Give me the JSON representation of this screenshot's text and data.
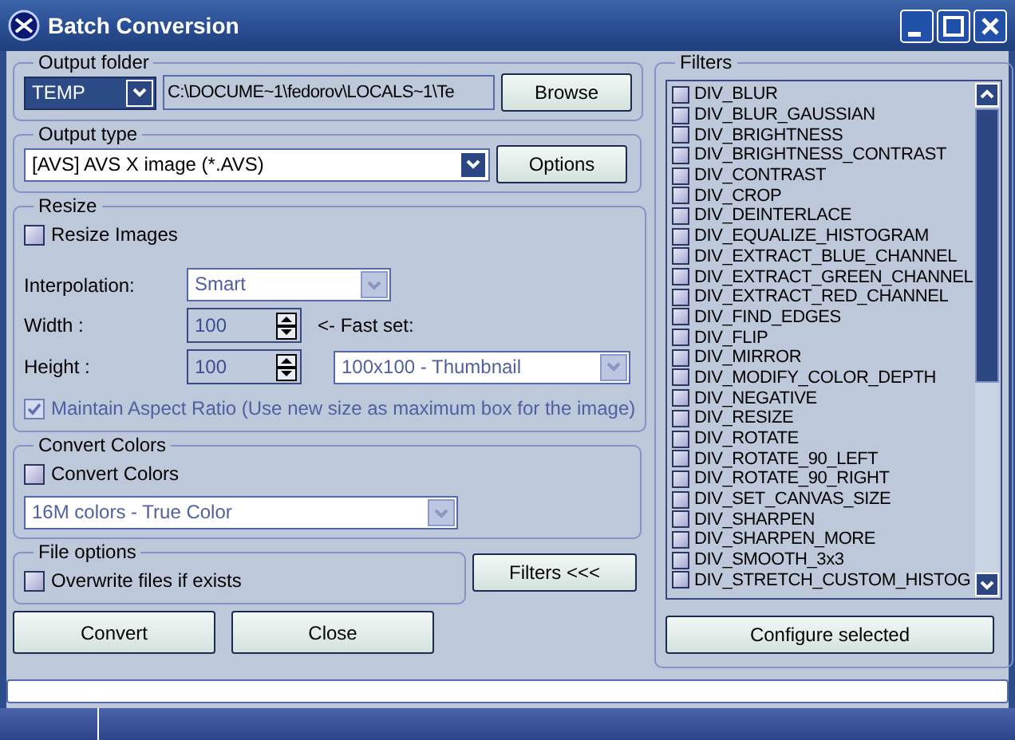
{
  "window": {
    "title": "Batch Conversion"
  },
  "output_folder": {
    "label": "Output folder",
    "folder_select": {
      "value": "TEMP"
    },
    "path": {
      "value": "C:\\DOCUME~1\\fedorov\\LOCALS~1\\Te"
    },
    "browse_button": "Browse"
  },
  "output_type": {
    "label": "Output type",
    "format_select": {
      "value": "[AVS] AVS X image (*.AVS)"
    },
    "options_button": "Options"
  },
  "resize": {
    "label": "Resize",
    "resize_images": {
      "label": "Resize Images",
      "checked": false
    },
    "interpolation": {
      "label": "Interpolation:",
      "value": "Smart",
      "disabled": true
    },
    "width": {
      "label": "Width :",
      "value": "100"
    },
    "height": {
      "label": "Height :",
      "value": "100"
    },
    "fast_set": {
      "label": "<- Fast set:",
      "value": "100x100 - Thumbnail",
      "disabled": true
    },
    "maintain_aspect": {
      "label": "Maintain Aspect Ratio (Use new size as maximum box for the image)",
      "checked": true,
      "disabled": true
    }
  },
  "convert_colors": {
    "label": "Convert Colors",
    "checkbox": {
      "label": "Convert Colors",
      "checked": false
    },
    "color_select": {
      "value": "16M colors - True Color",
      "disabled": true
    }
  },
  "file_options": {
    "label": "File options",
    "overwrite": {
      "label": "Overwrite files if exists",
      "checked": false
    }
  },
  "filters_button": "Filters <<<",
  "convert_button": "Convert",
  "close_button": "Close",
  "progress": {
    "level": 0
  },
  "filters": {
    "label": "Filters",
    "items": [
      {
        "label": "DIV_BLUR",
        "checked": false
      },
      {
        "label": "DIV_BLUR_GAUSSIAN",
        "checked": false
      },
      {
        "label": "DIV_BRIGHTNESS",
        "checked": false
      },
      {
        "label": "DIV_BRIGHTNESS_CONTRAST",
        "checked": false
      },
      {
        "label": "DIV_CONTRAST",
        "checked": false
      },
      {
        "label": "DIV_CROP",
        "checked": false
      },
      {
        "label": "DIV_DEINTERLACE",
        "checked": false
      },
      {
        "label": "DIV_EQUALIZE_HISTOGRAM",
        "checked": false
      },
      {
        "label": "DIV_EXTRACT_BLUE_CHANNEL",
        "checked": false
      },
      {
        "label": "DIV_EXTRACT_GREEN_CHANNEL",
        "checked": false
      },
      {
        "label": "DIV_EXTRACT_RED_CHANNEL",
        "checked": false
      },
      {
        "label": "DIV_FIND_EDGES",
        "checked": false
      },
      {
        "label": "DIV_FLIP",
        "checked": false
      },
      {
        "label": "DIV_MIRROR",
        "checked": false
      },
      {
        "label": "DIV_MODIFY_COLOR_DEPTH",
        "checked": false
      },
      {
        "label": "DIV_NEGATIVE",
        "checked": false
      },
      {
        "label": "DIV_RESIZE",
        "checked": false
      },
      {
        "label": "DIV_ROTATE",
        "checked": false
      },
      {
        "label": "DIV_ROTATE_90_LEFT",
        "checked": false
      },
      {
        "label": "DIV_ROTATE_90_RIGHT",
        "checked": false
      },
      {
        "label": "DIV_SET_CANVAS_SIZE",
        "checked": false
      },
      {
        "label": "DIV_SHARPEN",
        "checked": false
      },
      {
        "label": "DIV_SHARPEN_MORE",
        "checked": false
      },
      {
        "label": "DIV_SMOOTH_3x3",
        "checked": false
      },
      {
        "label": "DIV_STRETCH_CUSTOM_HISTOG",
        "checked": false
      }
    ],
    "configure_button": "Configure selected"
  }
}
